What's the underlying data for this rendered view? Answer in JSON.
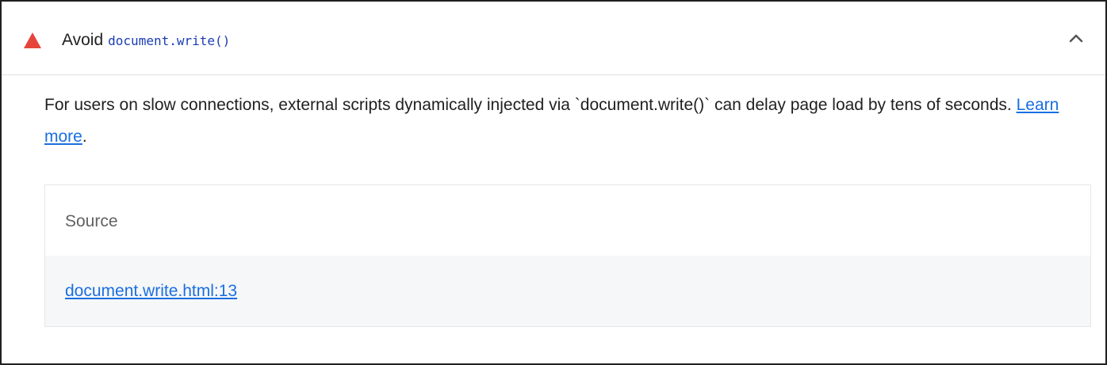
{
  "audit": {
    "status_icon": "warning-triangle-icon",
    "status_color": "#e6443b",
    "title_prefix": "Avoid",
    "title_code": "document.write()",
    "expand_icon": "chevron-up-icon"
  },
  "description": {
    "text": "For users on slow connections, external scripts dynamically injected via `document.write()` can delay page load by tens of seconds. ",
    "link_label": "Learn more",
    "suffix": "."
  },
  "table": {
    "header": "Source",
    "rows": [
      {
        "source": "document.write.html:13"
      }
    ]
  },
  "colors": {
    "link": "#1a6fe0",
    "code": "#1a3cb3",
    "row_background": "#f6f7f9"
  }
}
